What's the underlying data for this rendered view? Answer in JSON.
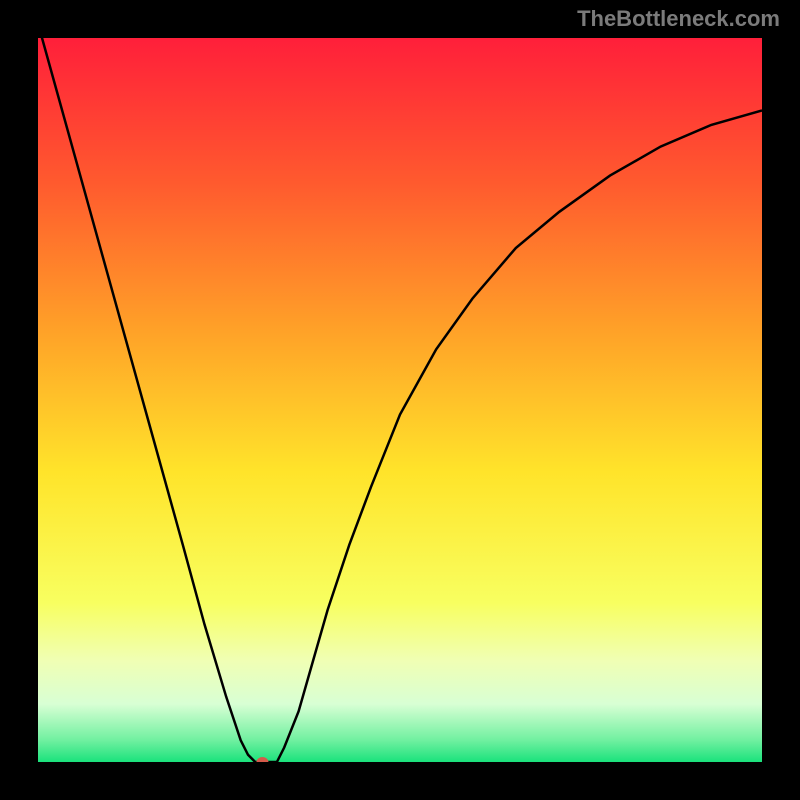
{
  "watermark": "TheBottleneck.com",
  "chart_data": {
    "type": "line",
    "title": "",
    "xlabel": "",
    "ylabel": "",
    "xlim": [
      0,
      100
    ],
    "ylim": [
      0,
      100
    ],
    "plot_background": {
      "type": "vertical_gradient",
      "stops": [
        {
          "pos": 0.0,
          "color": "#ff1f3a"
        },
        {
          "pos": 0.2,
          "color": "#ff5a2e"
        },
        {
          "pos": 0.4,
          "color": "#ffa028"
        },
        {
          "pos": 0.6,
          "color": "#ffe42a"
        },
        {
          "pos": 0.78,
          "color": "#f8ff60"
        },
        {
          "pos": 0.86,
          "color": "#f0ffb4"
        },
        {
          "pos": 0.92,
          "color": "#d8ffd4"
        },
        {
          "pos": 0.97,
          "color": "#70f0a0"
        },
        {
          "pos": 1.0,
          "color": "#1ae27c"
        }
      ]
    },
    "minimum_marker": {
      "x": 31,
      "y": 0,
      "color": "#d45a4a"
    },
    "series": [
      {
        "name": "curve",
        "color": "#000000",
        "x": [
          0,
          5,
          10,
          15,
          20,
          23,
          26,
          28,
          29,
          30,
          31,
          33,
          34,
          36,
          38,
          40,
          43,
          46,
          50,
          55,
          60,
          66,
          72,
          79,
          86,
          93,
          100
        ],
        "y": [
          102,
          84,
          66,
          48,
          30,
          19,
          9,
          3,
          1,
          0,
          0,
          0,
          2,
          7,
          14,
          21,
          30,
          38,
          48,
          57,
          64,
          71,
          76,
          81,
          85,
          88,
          90
        ]
      }
    ]
  }
}
